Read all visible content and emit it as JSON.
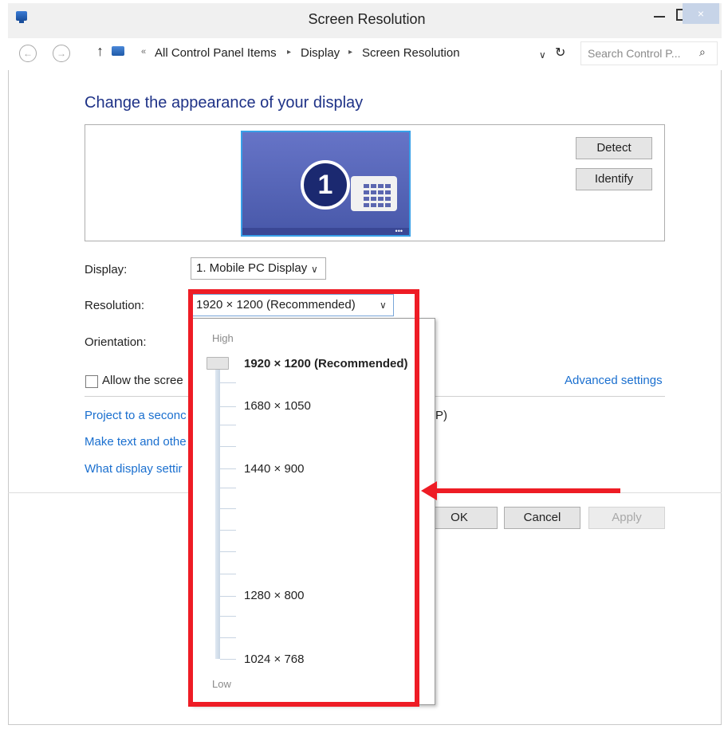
{
  "window": {
    "title": "Screen Resolution",
    "close_glyph": "×"
  },
  "nav": {
    "back_glyph": "←",
    "forward_glyph": "→",
    "up_glyph": "↑",
    "breadcrumb_prefix": "«",
    "breadcrumb": [
      "All Control Panel Items",
      "Display",
      "Screen Resolution"
    ],
    "search_placeholder": "Search Control P...",
    "search_icon_glyph": "⌕",
    "refresh_glyph": "↻",
    "dropdown_glyph": "∨"
  },
  "page": {
    "heading": "Change the appearance of your display",
    "monitor_number": "1",
    "monitor_dots": "•••",
    "detect_button": "Detect",
    "identify_button": "Identify",
    "display_label": "Display:",
    "display_value": "1. Mobile PC Display",
    "resolution_label": "Resolution:",
    "resolution_value": "1920 × 1200 (Recommended)",
    "orientation_label": "Orientation:",
    "allow_checkbox_label": "Allow the scree",
    "advanced_settings_link": "Advanced settings",
    "project_link": "Project to a seconc",
    "project_suffix": "P)",
    "make_text_link": "Make text and othe",
    "what_display_link": "What display settir",
    "ok_button": "OK",
    "cancel_button": "Cancel",
    "apply_button": "Apply",
    "chevron_glyph": "∨"
  },
  "resolution_dropdown": {
    "high_label": "High",
    "low_label": "Low",
    "options": [
      "1920 × 1200 (Recommended)",
      "1680 × 1050",
      "1440 × 900",
      "1280 × 800",
      "1024 × 768"
    ],
    "selected": "1920 × 1200 (Recommended)"
  },
  "annotation": {
    "highlight_color": "#ee1c25"
  }
}
